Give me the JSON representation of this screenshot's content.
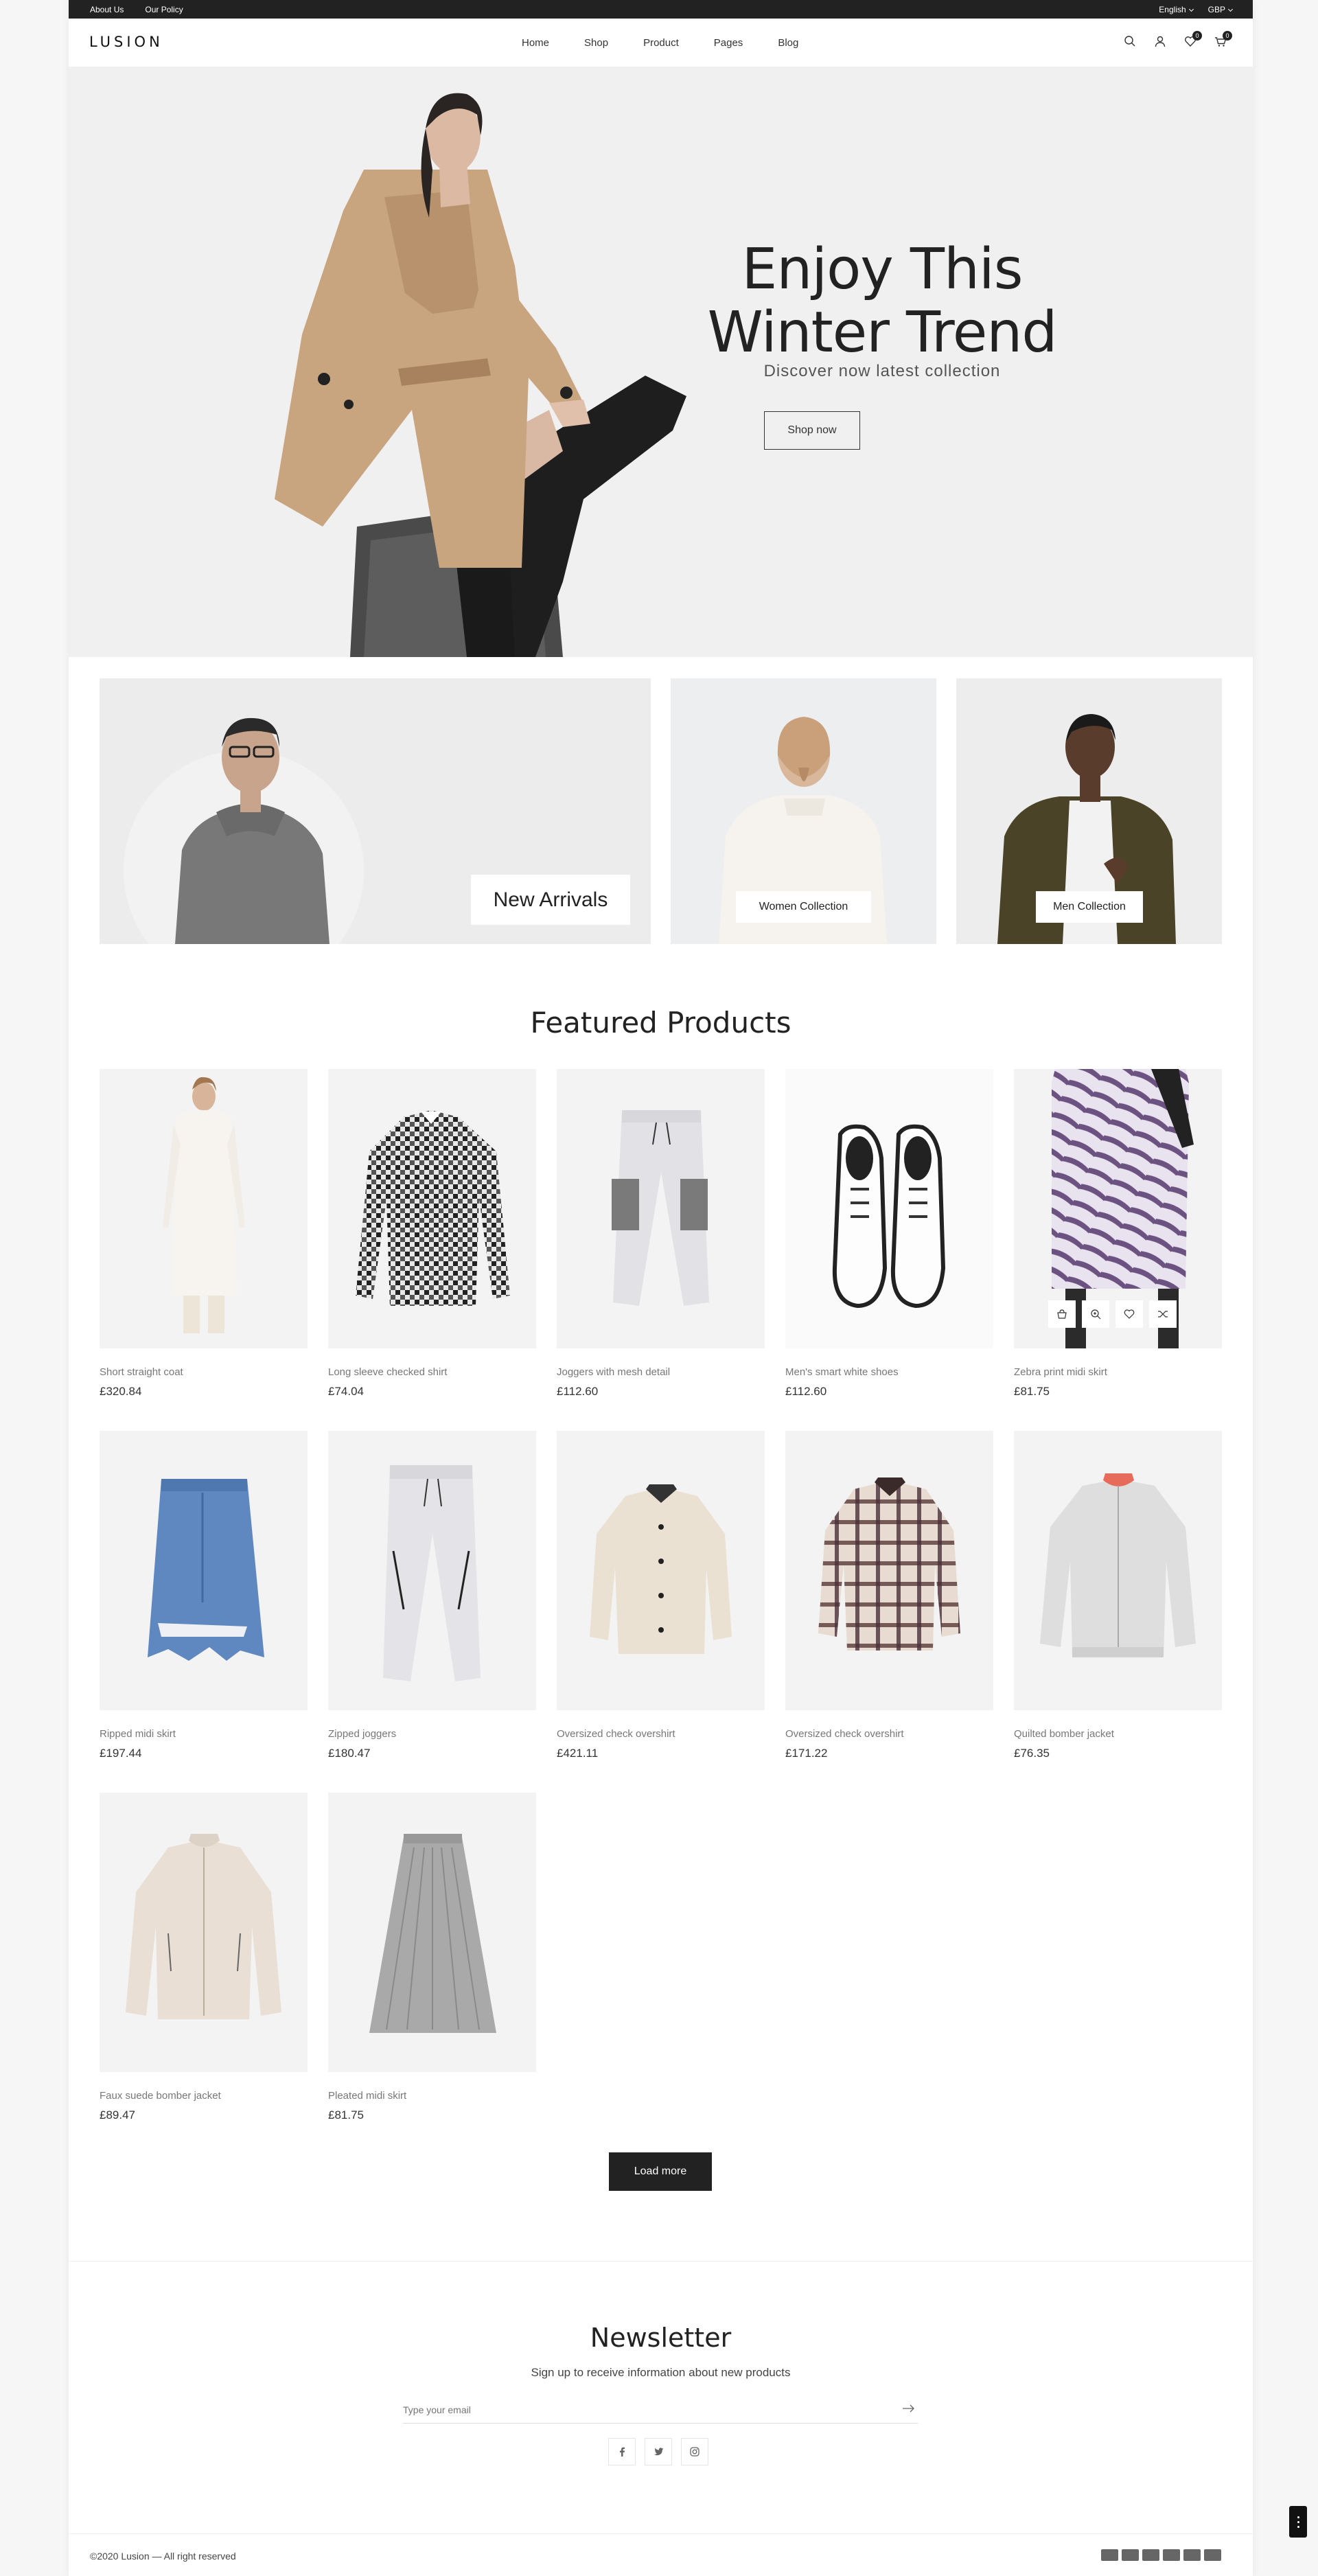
{
  "topbar": {
    "links": [
      "About Us",
      "Our Policy"
    ],
    "language": "English",
    "currency": "GBP"
  },
  "header": {
    "logo": "LUSION",
    "nav": [
      "Home",
      "Shop",
      "Product",
      "Pages",
      "Blog"
    ],
    "wishlist_count": "0",
    "cart_count": "0"
  },
  "hero": {
    "title_line1": "Enjoy This",
    "title_line2": "Winter Trend",
    "subtitle": "Discover now latest collection",
    "button": "Shop now"
  },
  "collections": [
    {
      "label": "New Arrivals"
    },
    {
      "label": "Women Collection"
    },
    {
      "label": "Men Collection"
    }
  ],
  "featured": {
    "title": "Featured Products",
    "products": [
      {
        "name": "Short straight coat",
        "price": "£320.84"
      },
      {
        "name": "Long sleeve checked shirt",
        "price": "£74.04"
      },
      {
        "name": "Joggers with mesh detail",
        "price": "£112.60"
      },
      {
        "name": "Men's smart white shoes",
        "price": "£112.60"
      },
      {
        "name": "Zebra print midi skirt",
        "price": "£81.75"
      },
      {
        "name": "Ripped midi skirt",
        "price": "£197.44"
      },
      {
        "name": "Zipped joggers",
        "price": "£180.47"
      },
      {
        "name": "Oversized check overshirt",
        "price": "£421.11"
      },
      {
        "name": "Oversized check overshirt",
        "price": "£171.22"
      },
      {
        "name": "Quilted bomber jacket",
        "price": "£76.35"
      },
      {
        "name": "Faux suede bomber jacket",
        "price": "£89.47"
      },
      {
        "name": "Pleated midi skirt",
        "price": "£81.75"
      }
    ],
    "load_more": "Load more"
  },
  "newsletter": {
    "title": "Newsletter",
    "subtitle": "Sign up to receive information about new products",
    "placeholder": "Type your email"
  },
  "footer": {
    "copyright": "©2020 Lusion — All right reserved"
  }
}
